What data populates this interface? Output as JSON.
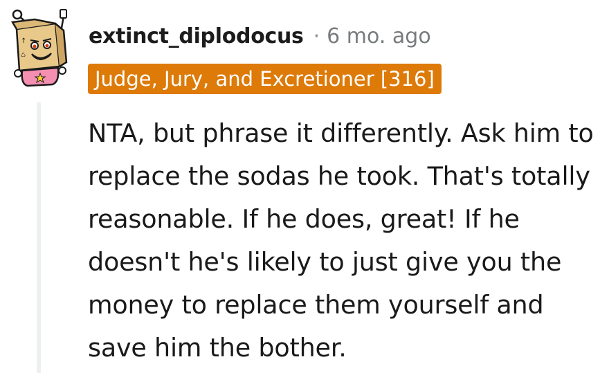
{
  "comment": {
    "author": "extinct_diplodocus",
    "separator": "·",
    "timestamp": "6 mo. ago",
    "flair": "Judge, Jury, and Excretioner [316]",
    "body": "NTA, but phrase it differently. Ask him to replace the sodas he took. That's totally reasonable. If he does, great! If he doesn't he's likely to just give you the money to replace them yourself and save him the bother.",
    "avatar_icon": "snoo-cardboard-box-avatar-icon"
  },
  "colors": {
    "flair_background": "#dd7a08",
    "flair_text": "#ffffff",
    "thread_line": "#edeff1",
    "timestamp": "#787c7e"
  }
}
